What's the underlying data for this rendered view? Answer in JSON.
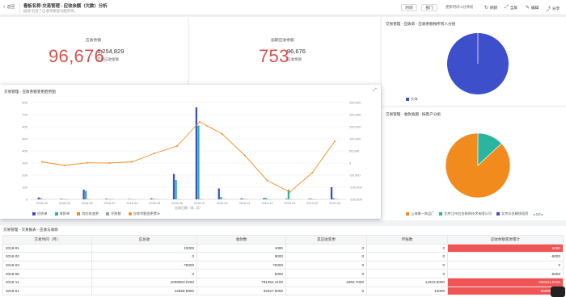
{
  "topbar": {
    "back_label": "返回",
    "title": "看板名称·交易管理 - 应收余额（欠款）分析",
    "subtitle": "描述:包含了应收余额变动趋势等。",
    "btn_time": "时间",
    "btn_dept": "部门",
    "update_info": "更新时间:1分钟前",
    "refresh": "刷新",
    "fullscreen": "全屏",
    "edit": "编辑",
    "share": "分享"
  },
  "kpi1": {
    "label": "应收余额",
    "value": "96,676",
    "side_value": "1,254,829",
    "side_label": "实际应收金额"
  },
  "kpi2": {
    "label": "逾期应收余额",
    "value": "753",
    "side_value": "96,676",
    "side_label": "应收余额"
  },
  "pie1": {
    "title": "交易管理 - 应收单 - 应收余额按所有人分组",
    "legend": [
      "大海"
    ],
    "colors": [
      "#3e4fcb"
    ]
  },
  "pie2": {
    "title": "交易管理 - 收款逾期 - 按客户分组",
    "legend": [
      "上海美一饰品厂",
      "北京江州五金装饰技术有限公司",
      "北京众金精钱投资"
    ],
    "pager": "1/2",
    "colors": [
      "#f28b1e",
      "#2bb5a0",
      "#3e4fcb"
    ],
    "slices": [
      0.87,
      0.13
    ]
  },
  "trend": {
    "title": "交易管理 - 应收余额变更趋势图",
    "xaxis_title": "交易日期（年, 月）"
  },
  "chart_data": {
    "type": "bar",
    "categories": [
      "2018-03",
      "2018-06",
      "2018-08",
      "2018-20",
      "2018-44",
      "2018-45",
      "2018-46",
      "2018-37",
      "2018-01",
      "2018-11",
      "2018-12",
      "2019-04",
      "2019-20",
      "2019-06"
    ],
    "ylim_left": [
      0,
      800
    ],
    "ylim_right": [
      -150000,
      250000
    ],
    "left_ticks": [
      "800",
      "700",
      "600",
      "500",
      "400",
      "300",
      "200",
      "100",
      "0"
    ],
    "right_ticks": [
      "250,000",
      "200,000",
      "150,000",
      "100,000",
      "50,000",
      "0",
      "-50,000",
      "-100,000",
      "-150,000"
    ],
    "series": [
      {
        "name": "应收单",
        "color": "#3e4fcb",
        "values": [
          15,
          5,
          80,
          5,
          3,
          8,
          210,
          760,
          90,
          8,
          10,
          5,
          4,
          100
        ]
      },
      {
        "name": "收款单",
        "color": "#2bb5a0",
        "values": [
          10,
          2,
          70,
          3,
          2,
          5,
          160,
          610,
          20,
          5,
          12,
          80,
          6,
          10
        ]
      },
      {
        "name": "其应收变更",
        "color": "#f28b1e",
        "values": [
          3,
          1,
          2,
          1,
          1,
          2,
          3,
          5,
          3,
          2,
          1,
          2,
          1,
          3
        ]
      },
      {
        "name": "坏账数",
        "color": "#9aa0aa",
        "values": [
          2,
          1,
          1,
          1,
          1,
          1,
          2,
          3,
          2,
          1,
          1,
          1,
          1,
          2
        ]
      },
      {
        "name": "应收余额变更累计",
        "type": "line",
        "color": "#f28b1e",
        "values": [
          5000,
          -10000,
          1000,
          0,
          5000,
          40000,
          70000,
          170000,
          120000,
          32000,
          -72000,
          -120000,
          -40000,
          90000
        ]
      }
    ]
  },
  "table": {
    "title": "交易管理 - 交易报表 - 应收与收款",
    "columns": [
      "交易时间（月）",
      "应总收",
      "收款数",
      "其应收变更",
      "坏账数",
      "应收余额变更累计"
    ],
    "rows": [
      [
        "2018-01",
        "10000",
        "1000",
        "0",
        "0",
        "9000"
      ],
      [
        "2018-02",
        "0",
        "9000",
        "0",
        "0",
        "-9000"
      ],
      [
        "2018-03",
        "75000",
        "75000",
        "0",
        "0",
        "0"
      ],
      [
        "2018-06",
        "0",
        "5000",
        "0",
        "0",
        "-5000"
      ],
      [
        "2018-11",
        "1059863.0200",
        "761352.4100",
        "4692.7000",
        "14323.6000",
        "308341.0100"
      ],
      [
        "2019-01",
        "14556.9900",
        "93227.6000",
        "0",
        "10000",
        "-88666.9100"
      ]
    ]
  }
}
